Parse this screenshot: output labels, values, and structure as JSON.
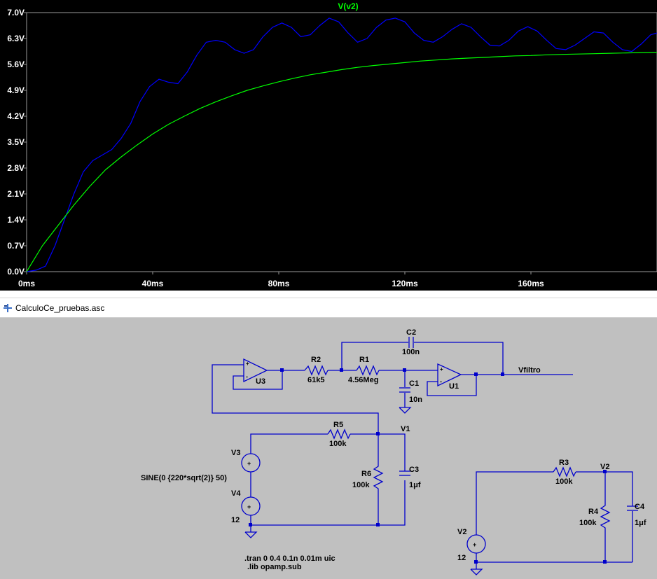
{
  "waveform": {
    "trace_label": "V(v2)",
    "trace_color": "#00ff00",
    "background": "#000000",
    "axis_color": "#9a9a9a",
    "tick_label_color": "#ffffff",
    "chart_data": {
      "type": "line",
      "title": "V(v2)",
      "xlabel": "",
      "ylabel": "",
      "x_unit": "ms",
      "xlim": [
        0,
        200
      ],
      "ylim": [
        0,
        7.0
      ],
      "x_ticks": [
        "0ms",
        "40ms",
        "80ms",
        "120ms",
        "160ms"
      ],
      "y_ticks": [
        "0.0V",
        "0.7V",
        "1.4V",
        "2.1V",
        "2.8V",
        "3.5V",
        "4.2V",
        "4.9V",
        "5.6V",
        "6.3V",
        "7.0V"
      ],
      "series": [
        {
          "color": "#0000ff",
          "x": [
            0,
            3,
            6,
            9,
            12,
            15,
            18,
            21,
            24,
            27,
            30,
            33,
            36,
            39,
            42,
            45,
            48,
            51,
            54,
            57,
            60,
            63,
            66,
            69,
            72,
            75,
            78,
            81,
            84,
            87,
            90,
            93,
            96,
            99,
            102,
            105,
            108,
            111,
            114,
            117,
            120,
            123,
            126,
            129,
            132,
            135,
            138,
            141,
            144,
            147,
            150,
            153,
            156,
            159,
            162,
            165,
            168,
            171,
            174,
            177,
            180,
            183,
            186,
            189,
            192,
            195,
            198,
            200
          ],
          "y": [
            0.0,
            0.04,
            0.15,
            0.7,
            1.4,
            2.1,
            2.7,
            3.0,
            3.15,
            3.3,
            3.6,
            4.0,
            4.6,
            5.0,
            5.2,
            5.12,
            5.08,
            5.4,
            5.85,
            6.2,
            6.25,
            6.2,
            6.0,
            5.9,
            6.0,
            6.35,
            6.6,
            6.72,
            6.6,
            6.35,
            6.4,
            6.65,
            6.85,
            6.75,
            6.45,
            6.2,
            6.3,
            6.6,
            6.8,
            6.85,
            6.75,
            6.45,
            6.25,
            6.2,
            6.35,
            6.55,
            6.7,
            6.6,
            6.35,
            6.12,
            6.1,
            6.25,
            6.5,
            6.62,
            6.5,
            6.25,
            6.03,
            6.0,
            6.12,
            6.3,
            6.48,
            6.45,
            6.2,
            6.0,
            5.95,
            6.15,
            6.4,
            6.45
          ]
        },
        {
          "color": "#00ff00",
          "x": [
            0,
            5,
            10,
            15,
            20,
            25,
            30,
            35,
            40,
            45,
            50,
            55,
            60,
            65,
            70,
            75,
            80,
            85,
            90,
            95,
            100,
            105,
            110,
            115,
            120,
            125,
            130,
            135,
            140,
            145,
            150,
            155,
            160,
            165,
            170,
            175,
            180,
            185,
            190,
            195,
            200
          ],
          "y": [
            0.0,
            0.7,
            1.25,
            1.8,
            2.3,
            2.75,
            3.1,
            3.42,
            3.72,
            3.98,
            4.2,
            4.41,
            4.59,
            4.75,
            4.9,
            5.02,
            5.13,
            5.23,
            5.32,
            5.39,
            5.46,
            5.52,
            5.57,
            5.61,
            5.65,
            5.69,
            5.72,
            5.75,
            5.77,
            5.79,
            5.81,
            5.83,
            5.84,
            5.86,
            5.87,
            5.88,
            5.89,
            5.9,
            5.91,
            5.92,
            5.93
          ]
        }
      ]
    }
  },
  "window": {
    "title": "CalculoCe_pruebas.asc"
  },
  "schematic": {
    "wire_color": "#0000cc",
    "labels": {
      "C2": "C2",
      "C2_val": "100n",
      "R2": "R2",
      "R2_val": "61k5",
      "R1": "R1",
      "R1_val": "4.56Meg",
      "C1": "C1",
      "C1_val": "10n",
      "U3": "U3",
      "U1": "U1",
      "Vfiltro": "Vfiltro",
      "R5": "R5",
      "R5_val": "100k",
      "V1": "V1",
      "V3": "V3",
      "sine": "SINE(0 {220*sqrt(2)} 50)",
      "V4": "V4",
      "V4_val": "12",
      "R6": "R6",
      "R6_val": "100k",
      "C3": "C3",
      "C3_val": "1μf",
      "R3": "R3",
      "R3_val": "100k",
      "V2_node": "V2",
      "R4": "R4",
      "R4_val": "100k",
      "C4": "C4",
      "C4_val": "1μf",
      "V2_src": "V2",
      "V2_val": "12",
      "plus": "+",
      "minus": "-"
    },
    "directives": [
      ".tran 0 0.4 0.1n 0.01m uic",
      ".lib opamp.sub"
    ]
  }
}
